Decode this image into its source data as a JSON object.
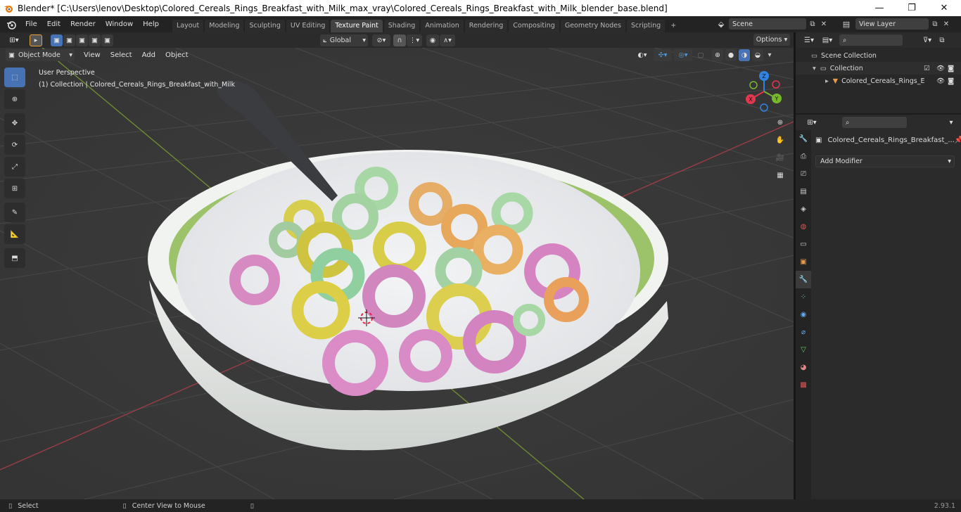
{
  "window": {
    "title": "Blender* [C:\\Users\\lenov\\Desktop\\Colored_Cereals_Rings_Breakfast_with_Milk_max_vray\\Colored_Cereals_Rings_Breakfast_with_Milk_blender_base.blend]",
    "minimize": "—",
    "maximize": "❐",
    "close": "✕"
  },
  "menu": [
    "File",
    "Edit",
    "Render",
    "Window",
    "Help"
  ],
  "workspaces": {
    "tabs": [
      "Layout",
      "Modeling",
      "Sculpting",
      "UV Editing",
      "Texture Paint",
      "Shading",
      "Animation",
      "Rendering",
      "Compositing",
      "Geometry Nodes",
      "Scripting"
    ],
    "active": "Texture Paint",
    "add": "+"
  },
  "scene": {
    "name": "Scene",
    "view_layer": "View Layer"
  },
  "viewport_header": {
    "transform_orientation": "Global",
    "options": "Options",
    "mode": "Object Mode",
    "menus": [
      "View",
      "Select",
      "Add",
      "Object"
    ]
  },
  "viewport": {
    "perspective": "User Perspective",
    "collection_info": "(1) Collection | Colored_Cereals_Rings_Breakfast_with_Milk",
    "gizmo": {
      "z": "Z",
      "y": "Y",
      "x": "X"
    }
  },
  "outliner": {
    "root": "Scene Collection",
    "collection": "Collection",
    "object": "Colored_Cereals_Rings_E"
  },
  "properties": {
    "object_name": "Colored_Cereals_Rings_Breakfast_...",
    "add_modifier": "Add Modifier"
  },
  "statusbar": {
    "select": "Select",
    "center_view": "Center View to Mouse",
    "version": "2.93.1"
  },
  "colors": {
    "accent": "#4772b3",
    "active_tab": "#434343",
    "viewport_bg": "#393939",
    "header_bg": "#232323",
    "gizmo_x": "#e3364f",
    "gizmo_y": "#76b72c",
    "gizmo_z": "#2f84e3"
  }
}
